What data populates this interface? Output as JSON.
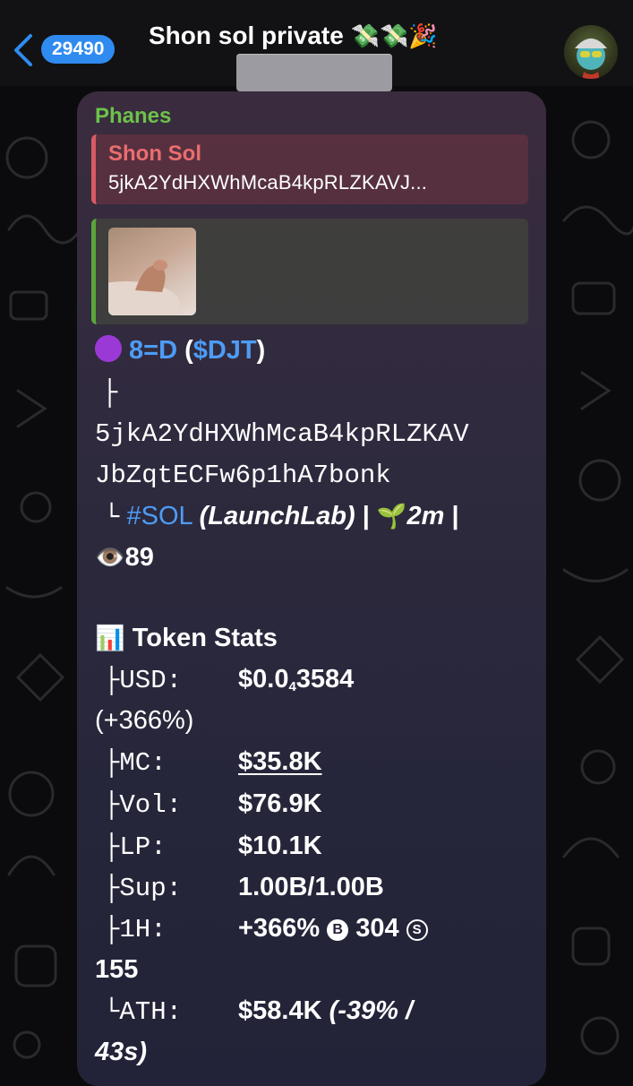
{
  "header": {
    "unread_count": "29490",
    "chat_title": "Shon sol private",
    "title_emojis": "💸💸🎉"
  },
  "message": {
    "sender": "Phanes",
    "reply": {
      "name": "Shon Sol",
      "text": "5jkA2YdHXWhMcaB4kpRLZKAVJ..."
    },
    "token_line": {
      "name": "8=D",
      "paren_open": " (",
      "ticker": "$DJT",
      "paren_close": ")"
    },
    "tree_branch": "├",
    "address_line1": "5jkA2YdHXWhMcaB4kpRLZKAV",
    "address_line2": "JbZqtECFw6p1hA7bonk",
    "tree_end": "└",
    "chain_tag": "#SOL",
    "platform": "(LaunchLab)",
    "sep": "|",
    "age_emoji": "🌱",
    "age": "2m",
    "views_emoji": "👁️",
    "views": "89",
    "stats_emoji": "📊",
    "stats_title": "Token Stats",
    "stats": {
      "usd_label": "├USD:",
      "usd_value_prefix": "$0.0",
      "usd_value_sub": "4",
      "usd_value_suffix": "3584",
      "usd_change": "(+366%)",
      "mc_label": "├MC:",
      "mc_value": "$35.8K",
      "vol_label": "├Vol:",
      "vol_value": "$76.9K",
      "lp_label": "├LP:",
      "lp_value": "$10.1K",
      "sup_label": "├Sup:",
      "sup_value": "1.00B/1.00B",
      "h1_label": "├1H:",
      "h1_change": "+366%",
      "h1_buy_icon": "B",
      "h1_buys": "304",
      "h1_sell_icon": "S",
      "h1_sells": "155",
      "ath_label": "└ATH:",
      "ath_value": "$58.4K",
      "ath_change_a": "(-39% /",
      "ath_change_b": "43s)"
    }
  },
  "colors": {
    "accent": "#2f8bf0",
    "sender": "#6cc24a",
    "reply_name": "#ea6d6f",
    "link": "#4d9cf6",
    "token_dot": "#9b39d6"
  }
}
